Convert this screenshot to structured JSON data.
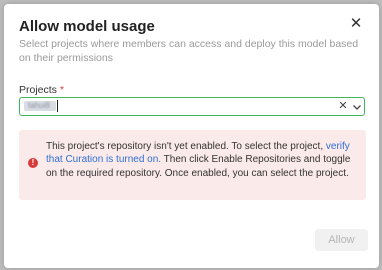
{
  "dialog": {
    "title": "Allow model usage",
    "subtitle": "Select projects where members can access and deploy this model based on their permissions",
    "close_glyph": "✕"
  },
  "projects_field": {
    "label": "Projects",
    "required_mark": "*",
    "selected_chip": "tahui8",
    "clear_glyph": "✕",
    "focus_border_color": "#3fb55d"
  },
  "alert": {
    "icon_glyph": "!",
    "text_before_link": "This project's repository isn't yet enabled. To select the project, ",
    "link_text": "verify that Curation is turned on.",
    "text_after_link": " Then click Enable Repositories and toggle on the required repository. Once enabled, you can select the project.",
    "background_color": "#fbeaea",
    "icon_color": "#d73a3a"
  },
  "footer": {
    "allow_label": "Allow",
    "allow_disabled": true
  }
}
